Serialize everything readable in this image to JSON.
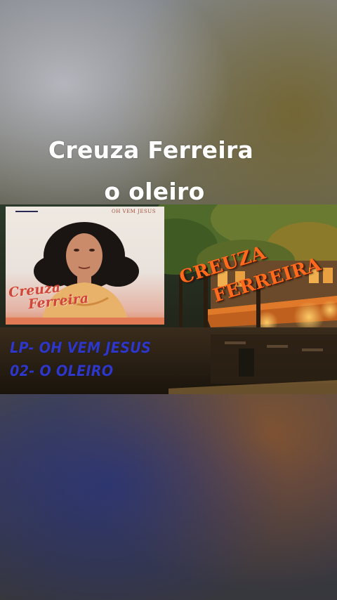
{
  "title": {
    "line1": "Creuza Ferreira",
    "line2": "o oleiro"
  },
  "album_cover": {
    "subtitle": "OH VEM JESUS",
    "name_line1": "Creuza",
    "name_line2": "Ferreira",
    "portrait": "woman-portrait-photo"
  },
  "overlay_artist": {
    "line1": "CREUZA",
    "line2": "FERREIRA",
    "color": "#ff6a1c"
  },
  "track_info": {
    "album_line": "LP- OH VEM JESUS",
    "track_line": "02- O OLEIRO",
    "color": "#2e37c8"
  },
  "background_scene": "night-street-cafe-trees"
}
